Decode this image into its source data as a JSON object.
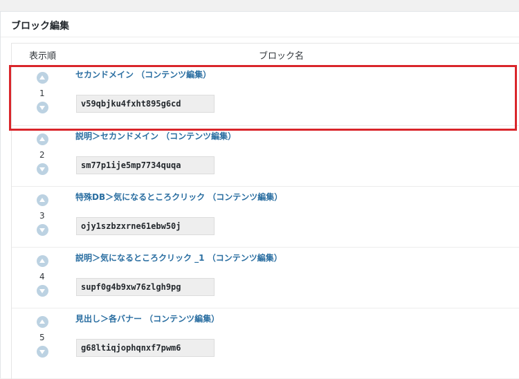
{
  "panel": {
    "title": "ブロック編集"
  },
  "table": {
    "col_order": "表示順",
    "col_name": "ブロック名"
  },
  "rows": [
    {
      "order": "1",
      "name": "セカンドメイン （コンテンツ編集）",
      "id": "v59qbjku4fxht895g6cd"
    },
    {
      "order": "2",
      "name": "説明＞セカンドメイン （コンテンツ編集）",
      "id": "sm77p1ije5mp7734quqa"
    },
    {
      "order": "3",
      "name": "特殊DB＞気になるところクリック （コンテンツ編集）",
      "id": "ojy1szbzxrne61ebw50j"
    },
    {
      "order": "4",
      "name": "説明＞気になるところクリック _1 （コンテンツ編集）",
      "id": "supf0g4b9xw76zlgh9pg"
    },
    {
      "order": "5",
      "name": "見出し＞各バナー （コンテンツ編集）",
      "id": "g68ltiqjophqnxf7pwm6"
    }
  ],
  "icons": {
    "up": "arrow-up-circle-icon",
    "down": "arrow-down-circle-icon"
  },
  "colors": {
    "link": "#2a6ea1",
    "arrow": "#bcd2e2",
    "highlight_border": "#d9252a"
  }
}
